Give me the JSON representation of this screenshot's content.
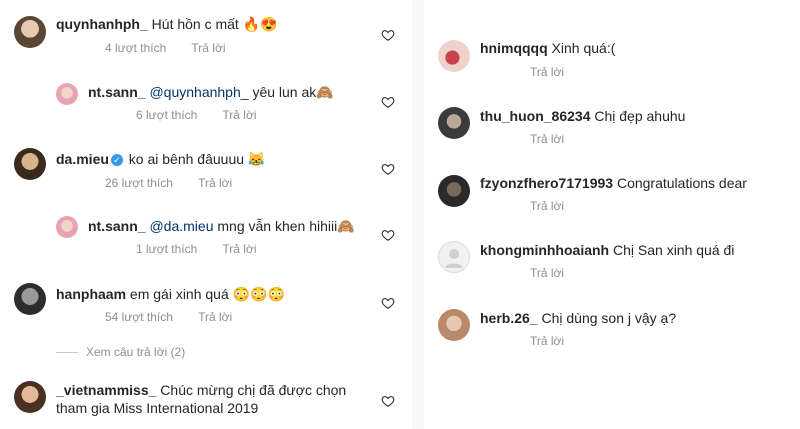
{
  "left_comments": [
    {
      "username": "quynhanhph_",
      "text": "Hút hồn c mất 🔥😍",
      "likes": "4 lượt thích",
      "reply": "Trả lời"
    },
    {
      "username": "nt.sann_",
      "mention": "@quynhanhph_",
      "text": "yêu lun ak🙈",
      "likes": "6 lượt thích",
      "reply": "Trả lời"
    },
    {
      "username": "da.mieu",
      "text": "ko ai bênh đâuuuu 😹",
      "likes": "26 lượt thích",
      "reply": "Trả lời"
    },
    {
      "username": "nt.sann_",
      "mention": "@da.mieu",
      "text": "mng vẫn khen hihiii🙈",
      "likes": "1 lượt thích",
      "reply": "Trả lời"
    },
    {
      "username": "hanphaam",
      "text": "em gái xinh quá 😳😳😳",
      "likes": "54 lượt thích",
      "reply": "Trả lời"
    },
    {
      "username": "_vietnammiss_",
      "text": "Chúc mừng chị đã được chọn",
      "text2": "tham gia Miss International 2019"
    }
  ],
  "view_replies": "Xem câu trả lời (2)",
  "right_comments": [
    {
      "username": "hnimqqqq",
      "text": "Xinh quá:(",
      "reply": "Trả lời"
    },
    {
      "username": "thu_huon_86234",
      "text": "Chị đẹp ahuhu",
      "reply": "Trả lời"
    },
    {
      "username": "fzyonzfhero7171993",
      "text": "Congratulations dear",
      "reply": "Trả lời"
    },
    {
      "username": "khongminhhoaianh",
      "text": "Chị San xinh quá đi",
      "reply": "Trả lời"
    },
    {
      "username": "herb.26_",
      "text": "Chị dùng son j vậy ạ?",
      "reply": "Trả lời"
    }
  ],
  "colors": {
    "text": "#262626",
    "meta": "#8e8e8e",
    "mention": "#00376b",
    "verified": "#3897f0"
  }
}
